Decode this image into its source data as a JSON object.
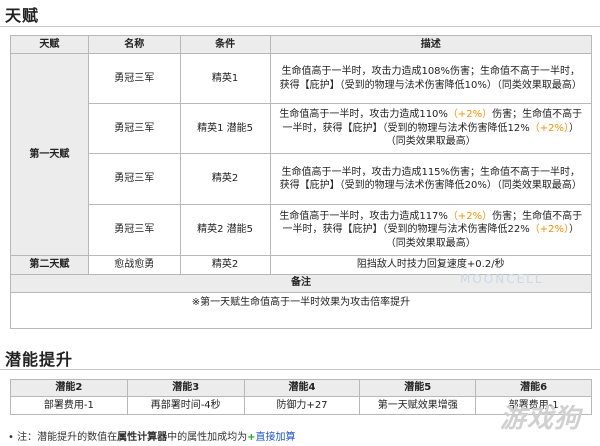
{
  "talent_section": {
    "title": "天赋"
  },
  "talent_table": {
    "headers": [
      "天赋",
      "名称",
      "条件",
      "描述"
    ],
    "group1_label": "第一天赋",
    "rows": [
      {
        "name": "勇冠三军",
        "cond": "精英1",
        "desc": [
          "生命值高于一半时，攻击力造成108%伤害；生命值不高于一半时，获得【庇护】（受到的物理与法术伤害降低10%）（同类效果取最高）"
        ]
      },
      {
        "name": "勇冠三军",
        "cond": "精英1 潜能5",
        "desc": [
          "生命值高于一半时，攻击力造成110%",
          "（+2%）",
          "伤害；生命值不高于一半时，获得【庇护】（受到的物理与法术伤害降低12%",
          "（+2%）",
          "）（同类效果取最高）"
        ]
      },
      {
        "name": "勇冠三军",
        "cond": "精英2",
        "desc": [
          "生命值高于一半时，攻击力造成115%伤害；生命值不高于一半时，获得【庇护】（受到的物理与法术伤害降低20%）（同类效果取最高）"
        ]
      },
      {
        "name": "勇冠三军",
        "cond": "精英2 潜能5",
        "desc": [
          "生命值高于一半时，攻击力造成117%",
          "（+2%）",
          "伤害；生命值不高于一半时，获得【庇护】（受到的物理与法术伤害降低22%",
          "（+2%）",
          "）（同类效果取最高）"
        ]
      }
    ],
    "group2": {
      "label": "第二天赋",
      "name": "愈战愈勇",
      "cond": "精英2",
      "desc": "阻挡敌人时技力回复速度+0.2/秒"
    },
    "note_header": "备注",
    "note_text": "※第一天赋生命值高于一半时效果为攻击倍率提升"
  },
  "potential_section": {
    "title": "潜能提升"
  },
  "potential_table": {
    "headers": [
      "潜能2",
      "潜能3",
      "潜能4",
      "潜能5",
      "潜能6"
    ],
    "values": [
      "部署费用-1",
      "再部署时间-4秒",
      "防御力+27",
      "第一天赋效果增强",
      "部署费用-1"
    ]
  },
  "footnote": {
    "prefix": "• 注：潜能提升的数值在",
    "strong": "属性计算器",
    "middle": "中的属性加成均为",
    "plus": "+",
    "link": "直接加算"
  },
  "watermark": {
    "text": "MOONCELL",
    "logo": "游戏狗"
  },
  "colors": {
    "highlight": "#f39000",
    "header_bg": "#ececec",
    "border": "#b8b8b8",
    "link": "#1a56c9",
    "plus": "#1fa81f"
  }
}
